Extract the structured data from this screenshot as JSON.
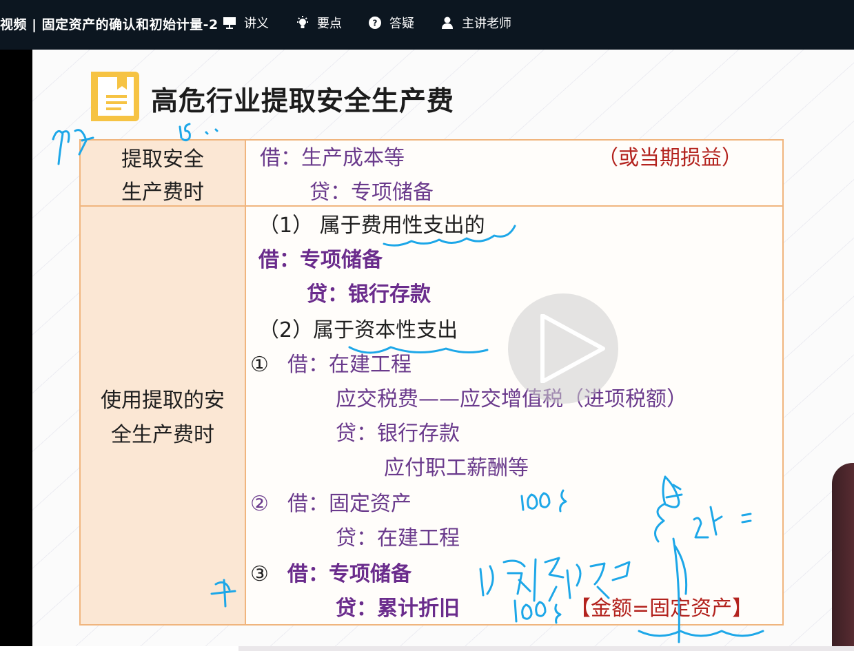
{
  "topbar": {
    "title": "视频 | 固定资产的确认和初始计量-2",
    "nav": [
      {
        "label": "讲义",
        "icon": "presentation-icon"
      },
      {
        "label": "要点",
        "icon": "lightbulb-icon"
      },
      {
        "label": "答疑",
        "icon": "question-bubble-icon"
      },
      {
        "label": "主讲老师",
        "icon": "teacher-icon"
      }
    ]
  },
  "slide": {
    "heading": "高危行业提取安全生产费",
    "row1": {
      "label_line1": "提取安全",
      "label_line2": "生产费时",
      "debit": "借：生产成本等",
      "debit_note": "（或当期损益）",
      "credit": "贷：专项储备"
    },
    "row2": {
      "label_line1": "使用提取的安",
      "label_line2": "全生产费时",
      "case1_title": "（1） 属于费用性支出的",
      "case1_debit": "借：专项储备",
      "case1_credit": "贷：银行存款",
      "case2_title": "（2）属于资本性支出",
      "step1_num": "①",
      "step1_debit": "借：在建工程",
      "step1_line2": "应交税费——应交增值税（进项税额）",
      "step1_credit": "贷：银行存款",
      "step1_credit2": "应付职工薪酬等",
      "step2_num": "②",
      "step2_debit": "借：固定资产",
      "step2_credit": "贷：在建工程",
      "step3_num": "③",
      "step3_debit": "借：专项储备",
      "step3_credit": "贷：累计折旧",
      "step3_note": "【金额=固定资产】"
    }
  },
  "colors": {
    "topbar_bg": "#0c1620",
    "left_cell_bg": "#fbe7d4",
    "border": "#f0b57e",
    "purple": "#6a3a8c",
    "red": "#b3231e",
    "ink_blue": "#1da7e8"
  }
}
